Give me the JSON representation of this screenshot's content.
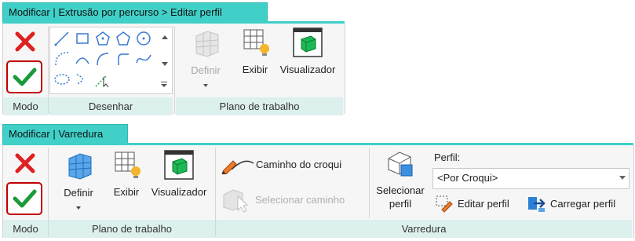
{
  "ribbon1": {
    "tab_title": "Modificar | Extrusão por percurso > Editar perfil",
    "panels": {
      "modo": "Modo",
      "desenhar": "Desenhar",
      "plano": "Plano de trabalho"
    },
    "buttons": {
      "definir": "Definir",
      "exibir": "Exibir",
      "visualizador": "Visualizador"
    }
  },
  "ribbon2": {
    "tab_title": "Modificar | Varredura",
    "panels": {
      "modo": "Modo",
      "plano": "Plano de trabalho",
      "varredura": "Varredura"
    },
    "buttons": {
      "definir": "Definir",
      "exibir": "Exibir",
      "visualizador": "Visualizador",
      "caminho_croqui": "Caminho do croqui",
      "selecionar_caminho": "Selecionar caminho",
      "selecionar_perfil_line1": "Selecionar",
      "selecionar_perfil_line2": "perfil",
      "perfil_label": "Perfil:",
      "perfil_value": "<Por Croqui>",
      "editar_perfil": "Editar perfil",
      "carregar_perfil": "Carregar perfil"
    }
  },
  "colors": {
    "context_tab": "#40d0c8",
    "panel_label_bg": "#dcf0ee",
    "cancel_red": "#e02020",
    "finish_green": "#1a9a3a",
    "highlight_border": "#c00000"
  }
}
